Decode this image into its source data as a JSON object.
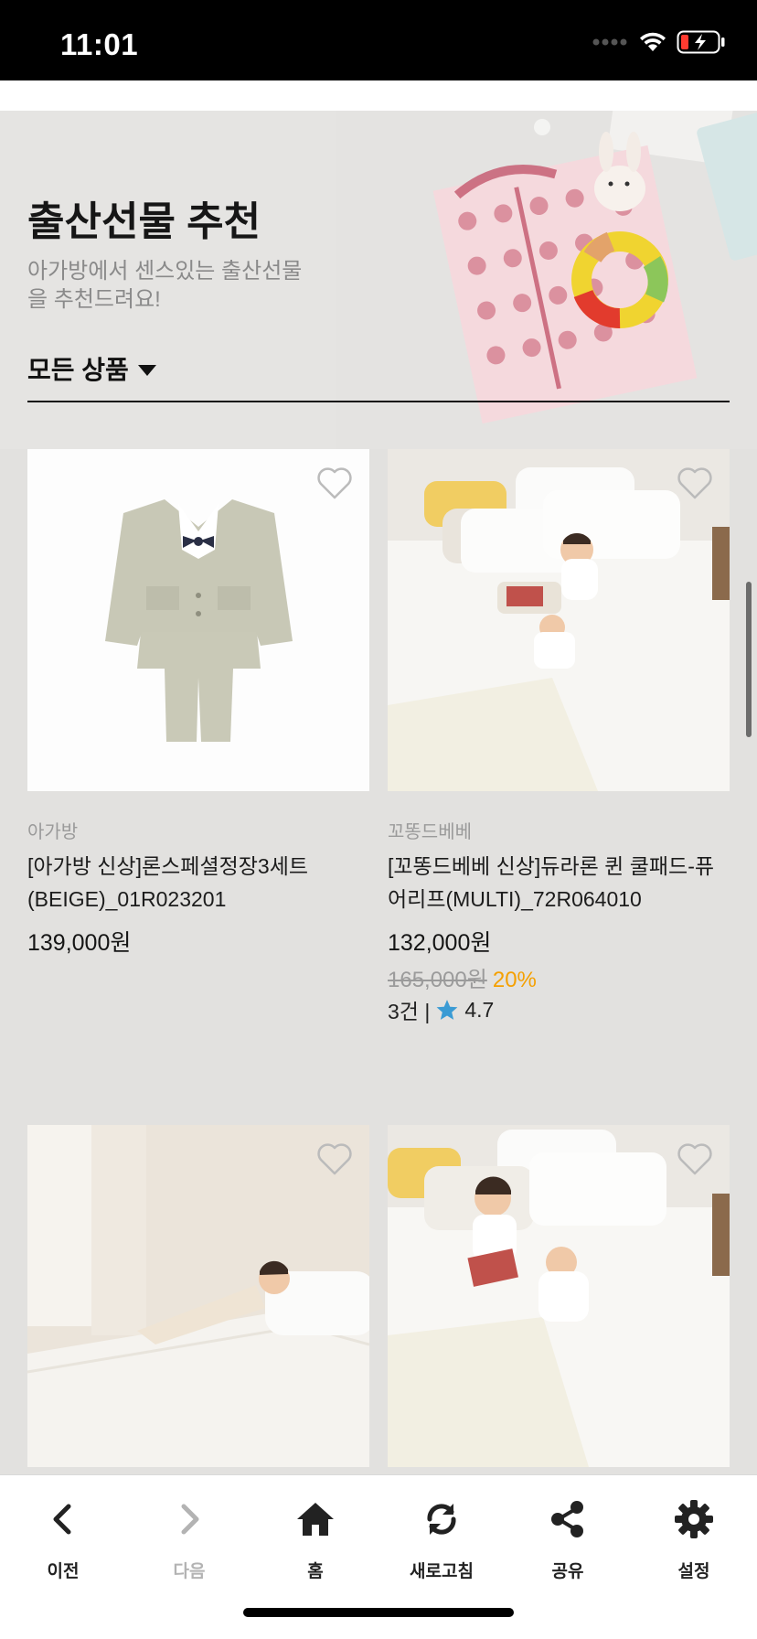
{
  "status_bar": {
    "time": "11:01"
  },
  "hero": {
    "title": "출산선물 추천",
    "subtitle": "아가방에서 센스있는 출산선물을 추천드려요!",
    "filter_label": "모든 상품"
  },
  "products": [
    {
      "brand": "아가방",
      "name": "[아가방 신상]론스페셜정장3세트(BEIGE)_01R023201",
      "price": "139,000원"
    },
    {
      "brand": "꼬똥드베베",
      "name": "[꼬똥드베베 신상]듀라론 퀸 쿨패드-퓨어리프(MULTI)_72R064010",
      "price": "132,000원",
      "original_price": "165,000원",
      "discount": "20%",
      "reviews": "3건 |",
      "rating": "4.7"
    },
    {
      "brand": "",
      "name": "",
      "price": ""
    },
    {
      "brand": "",
      "name": "",
      "price": ""
    }
  ],
  "bottom_nav": {
    "back": "이전",
    "forward": "다음",
    "home": "홈",
    "refresh": "새로고침",
    "share": "공유",
    "settings": "설정"
  },
  "colors": {
    "accent_orange": "#f5a000",
    "star_blue": "#3a9bd4"
  }
}
